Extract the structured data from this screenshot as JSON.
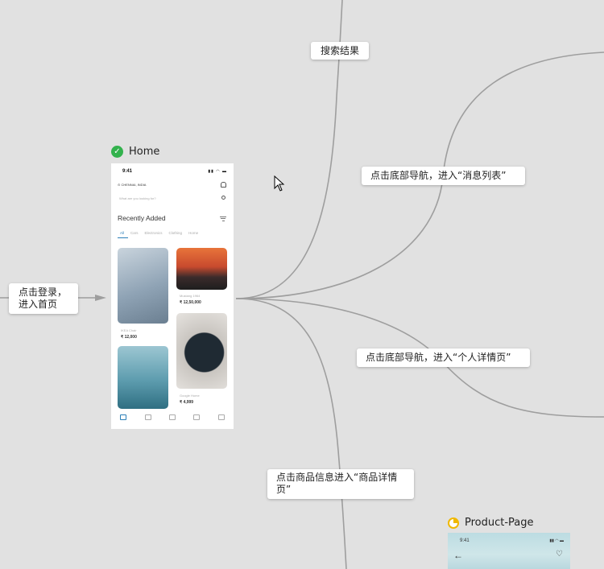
{
  "notes": {
    "search_results": "搜索结果",
    "messages": "点击底部导航，进入“消息列表”",
    "profile": "点击底部导航，进入“个人详情页”",
    "login_line1": "点击登录，",
    "login_line2": "进入首页",
    "product_line1": "点击商品信息进入“商品详情",
    "product_line2": "页”"
  },
  "frames": {
    "home": {
      "title": "Home",
      "status": "complete"
    },
    "product": {
      "title": "Product-Page",
      "status": "in-progress"
    }
  },
  "home_screen": {
    "time": "9:41",
    "location": "CHENNAI, INDIA",
    "search_placeholder": "What are you looking for?",
    "heading": "Recently Added",
    "tabs": [
      "All",
      "Cars",
      "Electronics",
      "Clothing",
      "Home"
    ],
    "products": [
      {
        "name": "IKEA Chair",
        "price": "12,000"
      },
      {
        "name": "Mustang 1964",
        "price": "12,50,000"
      },
      {
        "name": "Google Home",
        "price": "4,999"
      }
    ],
    "currency_symbol": "₹"
  },
  "product_screen": {
    "time": "9:41"
  },
  "colors": {
    "canvas": "#e1e1e1",
    "connector": "#9a9a9a",
    "check": "#33b24d",
    "pending": "#f0b800",
    "accent": "#2b7fb8"
  }
}
